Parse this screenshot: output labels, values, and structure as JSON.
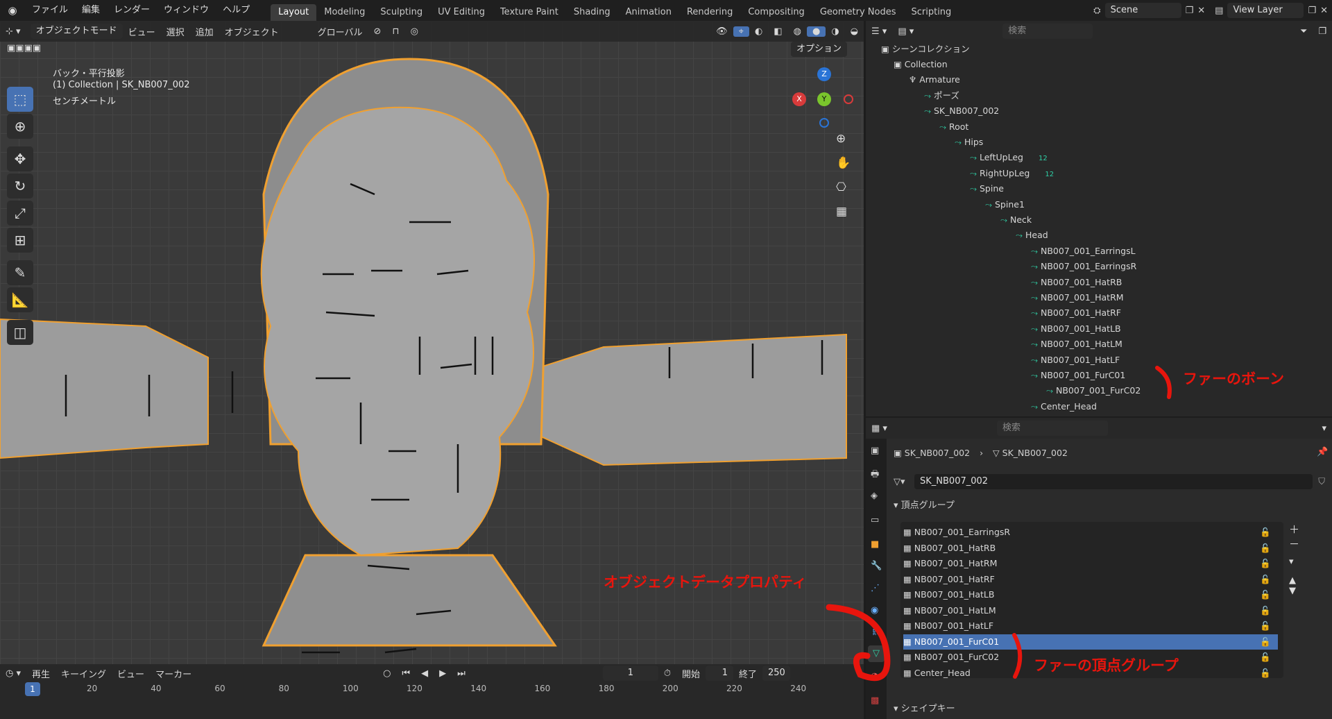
{
  "topbar": {
    "menus": [
      "ファイル",
      "編集",
      "レンダー",
      "ウィンドウ",
      "ヘルプ"
    ],
    "workspaces": [
      "Layout",
      "Modeling",
      "Sculpting",
      "UV Editing",
      "Texture Paint",
      "Shading",
      "Animation",
      "Rendering",
      "Compositing",
      "Geometry Nodes",
      "Scripting"
    ],
    "scene": "Scene",
    "view_layer": "View Layer"
  },
  "viewport": {
    "mode": "オブジェクトモード",
    "menus": [
      "ビュー",
      "選択",
      "追加",
      "オブジェクト"
    ],
    "transform": "グローバル",
    "options": "オプション",
    "info_line1": "バック・平行投影",
    "info_line2": "(1) Collection | SK_NB007_002",
    "info_line3": "センチメートル",
    "gizmo": {
      "z": "Z",
      "y": "Y",
      "x": "X"
    }
  },
  "timeline": {
    "playback": "再生",
    "keying": "キーイング",
    "view": "ビュー",
    "marker": "マーカー",
    "current_frame": "1",
    "start_label": "開始",
    "start": "1",
    "end_label": "終了",
    "end": "250",
    "ticks": [
      "1",
      "20",
      "40",
      "60",
      "80",
      "100",
      "120",
      "140",
      "160",
      "180",
      "200",
      "220",
      "240"
    ]
  },
  "outliner": {
    "search_placeholder": "検索",
    "scene_collection": "シーンコレクション",
    "items": [
      {
        "label": "Collection",
        "depth": 0
      },
      {
        "label": "Armature",
        "depth": 1
      },
      {
        "label": "ポーズ",
        "depth": 2
      },
      {
        "label": "SK_NB007_002",
        "depth": 2
      },
      {
        "label": "Root",
        "depth": 3
      },
      {
        "label": "Hips",
        "depth": 4
      },
      {
        "label": "LeftUpLeg",
        "depth": 5,
        "badge": "12"
      },
      {
        "label": "RightUpLeg",
        "depth": 5,
        "badge": "12"
      },
      {
        "label": "Spine",
        "depth": 5
      },
      {
        "label": "Spine1",
        "depth": 6
      },
      {
        "label": "Neck",
        "depth": 7
      },
      {
        "label": "Head",
        "depth": 8
      },
      {
        "label": "NB007_001_EarringsL",
        "depth": 9
      },
      {
        "label": "NB007_001_EarringsR",
        "depth": 9
      },
      {
        "label": "NB007_001_HatRB",
        "depth": 9
      },
      {
        "label": "NB007_001_HatRM",
        "depth": 9
      },
      {
        "label": "NB007_001_HatRF",
        "depth": 9
      },
      {
        "label": "NB007_001_HatLB",
        "depth": 9
      },
      {
        "label": "NB007_001_HatLM",
        "depth": 9
      },
      {
        "label": "NB007_001_HatLF",
        "depth": 9
      },
      {
        "label": "NB007_001_FurC01",
        "depth": 9
      },
      {
        "label": "NB007_001_FurC02",
        "depth": 10
      },
      {
        "label": "Center_Head",
        "depth": 9
      }
    ]
  },
  "properties": {
    "search_placeholder": "検索",
    "breadcrumb_object": "SK_NB007_002",
    "breadcrumb_data": "SK_NB007_002",
    "mesh_name": "SK_NB007_002",
    "vertex_groups_title": "頂点グループ",
    "vertex_groups": [
      "NB007_001_EarringsR",
      "NB007_001_HatRB",
      "NB007_001_HatRM",
      "NB007_001_HatRF",
      "NB007_001_HatLB",
      "NB007_001_HatLM",
      "NB007_001_HatLF",
      "NB007_001_FurC01",
      "NB007_001_FurC02",
      "Center_Head"
    ],
    "selected_group": "NB007_001_FurC01",
    "shape_keys_title": "シェイプキー"
  },
  "annotations": {
    "fur_bone": "ファーのボーン",
    "object_data_props": "オブジェクトデータプロパティ",
    "fur_vertex_group": "ファーの頂点グループ"
  },
  "colors": {
    "accent": "#4772b3",
    "annotation": "#e8150d",
    "bone": "#2fd0a6",
    "outline": "#f0a030"
  }
}
